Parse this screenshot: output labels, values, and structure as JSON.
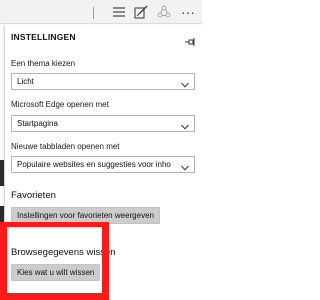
{
  "toolbar": {
    "icons": [
      "hub-icon",
      "web-note-icon",
      "share-icon",
      "more-icon"
    ],
    "more_glyph": "···"
  },
  "panel": {
    "title": "INSTELLINGEN",
    "theme": {
      "label": "Een thema kiezen",
      "value": "Licht"
    },
    "open_with": {
      "label": "Microsoft Edge openen met",
      "value": "Startpagina"
    },
    "new_tabs": {
      "label": "Nieuwe tabbladen openen met",
      "value": "Populaire websites en suggesties voor inho"
    },
    "favorites": {
      "heading": "Favorieten",
      "button": "Instellingen voor favorieten weergeven"
    },
    "browsing_data": {
      "heading": "Browsegegevens wissen",
      "button": "Kies wat u wilt wissen"
    }
  },
  "highlight_color": "#ff1a1a"
}
